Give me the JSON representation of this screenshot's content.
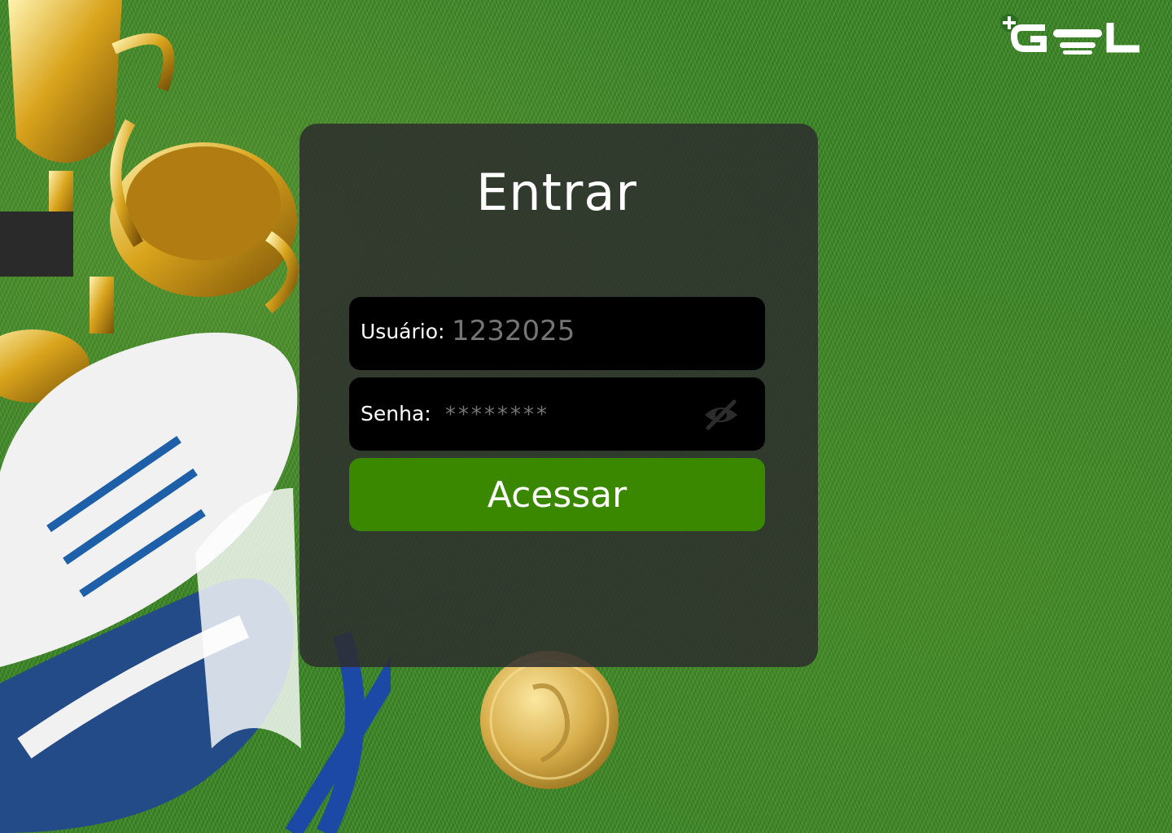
{
  "brand": {
    "name": "GOL",
    "logo_icon": "plus-gol-logo",
    "logo_color": "#ffffff",
    "plus_color": "#2b6e22"
  },
  "login": {
    "title": "Entrar",
    "username": {
      "label": "Usuário:",
      "placeholder": "1232025",
      "value": ""
    },
    "password": {
      "label": "Senha:",
      "placeholder": "********",
      "value": "",
      "toggle_icon": "eye-off-icon"
    },
    "submit_label": "Acessar"
  },
  "colors": {
    "card_background": "#2d2d2d",
    "input_background": "#000000",
    "accent_button": "#3a8700",
    "text": "#ffffff"
  },
  "background": {
    "theme": "soccer-field",
    "decorations": [
      "trophy-icon",
      "cleats-icon",
      "medal-icon"
    ]
  }
}
